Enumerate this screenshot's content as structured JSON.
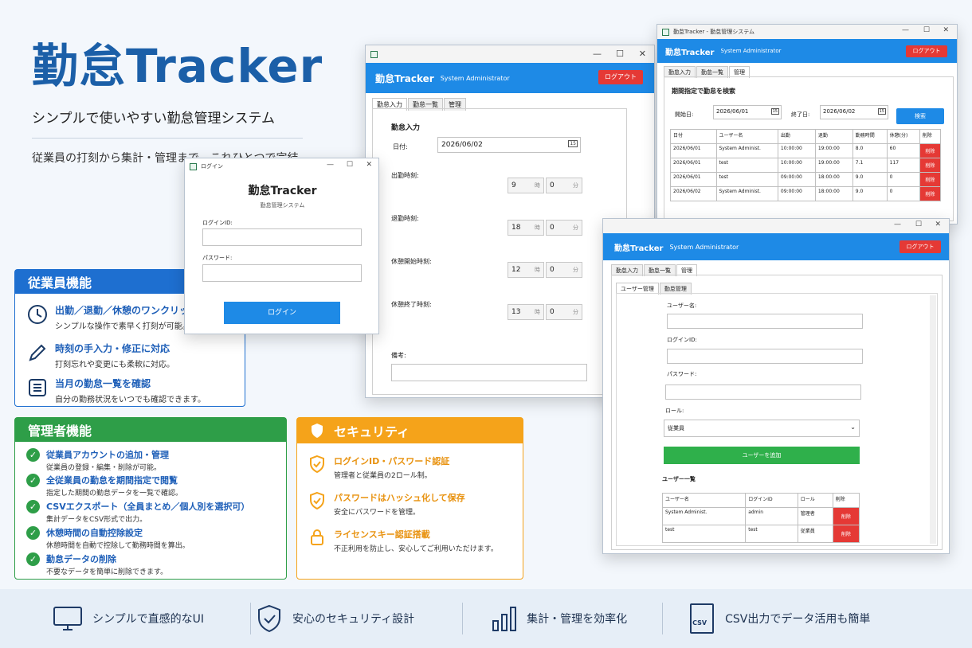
{
  "hero": {
    "title": "勤怠Tracker",
    "subtitle": "シンプルで使いやすい勤怠管理システム",
    "description": "従業員の打刻から集計・管理まで、これひとつで完結。"
  },
  "login_window": {
    "window_title": "ログイン",
    "app_name": "勤怠Tracker",
    "app_caption": "勤怠管理システム",
    "login_id_label": "ログインID:",
    "password_label": "パスワード:",
    "login_button": "ログイン"
  },
  "entry_window": {
    "brand": "勤怠Tracker",
    "user": "System Administrator",
    "logout": "ログアウト",
    "tabs": [
      "勤怠入力",
      "勤怠一覧",
      "管理"
    ],
    "section_title": "勤怠入力",
    "date_label": "日付:",
    "date_value": "2026/06/02",
    "calendar_label": "15",
    "hour_unit": "時",
    "minute_unit": "分",
    "rows": [
      {
        "label": "出勤時刻:",
        "hour": "9",
        "minute": "0"
      },
      {
        "label": "退勤時刻:",
        "hour": "18",
        "minute": "0"
      },
      {
        "label": "休憩開始時刻:",
        "hour": "12",
        "minute": "0"
      },
      {
        "label": "休憩終了時刻:",
        "hour": "13",
        "minute": "0"
      }
    ],
    "note_label": "備考:"
  },
  "list_window": {
    "window_title": "勤怠Tracker - 勤怠管理システム",
    "brand": "勤怠Tracker",
    "user": "System Administrator",
    "logout": "ログアウト",
    "tabs": [
      "勤怠入力",
      "勤怠一覧",
      "管理"
    ],
    "section_title": "期間指定で勤怠を検索",
    "start_label": "開始日:",
    "start_value": "2026/06/01",
    "end_label": "終了日:",
    "end_value": "2026/06/02",
    "calendar_label": "15",
    "search_button": "検索",
    "columns": [
      "日付",
      "ユーザー名",
      "出勤",
      "退勤",
      "勤務時間",
      "休憩(分)",
      "削除"
    ],
    "rows": [
      [
        "2026/06/01",
        "System Administ.",
        "10:00:00",
        "19:00:00",
        "8.0",
        "60",
        "削除"
      ],
      [
        "2026/06/01",
        "test",
        "10:00:00",
        "19:00:00",
        "7.1",
        "117",
        "削除"
      ],
      [
        "2026/06/01",
        "test",
        "09:00:00",
        "18:00:00",
        "9.0",
        "0",
        "削除"
      ],
      [
        "2026/06/02",
        "System Administ.",
        "09:00:00",
        "18:00:00",
        "9.0",
        "0",
        "削除"
      ]
    ]
  },
  "admin_window": {
    "brand": "勤怠Tracker",
    "user": "System Administrator",
    "logout": "ログアウト",
    "tabs": [
      "勤怠入力",
      "勤怠一覧",
      "管理"
    ],
    "sub_tabs": [
      "ユーザー管理",
      "勤怠管理"
    ],
    "username_label": "ユーザー名:",
    "login_id_label": "ログインID:",
    "password_label": "パスワード:",
    "role_label": "ロール:",
    "role_value": "従業員",
    "add_button": "ユーザーを追加",
    "list_title": "ユーザー一覧",
    "columns": [
      "ユーザー名",
      "ログインID",
      "ロール",
      "削除"
    ],
    "rows": [
      [
        "System Administ.",
        "admin",
        "管理者",
        "削除"
      ],
      [
        "test",
        "test",
        "従業員",
        "削除"
      ]
    ]
  },
  "employee_card": {
    "title": "従業員機能",
    "color": "#1e6fd0",
    "items": [
      {
        "title": "出勤／退勤／休憩のワンクリック打刻",
        "desc": "シンプルな操作で素早く打刻が可能。"
      },
      {
        "title": "時刻の手入力・修正に対応",
        "desc": "打刻忘れや変更にも柔軟に対応。"
      },
      {
        "title": "当月の勤怠一覧を確認",
        "desc": "自分の勤務状況をいつでも確認できます。"
      }
    ]
  },
  "admin_card": {
    "title": "管理者機能",
    "color": "#2e9e48",
    "items": [
      {
        "title": "従業員アカウントの追加・管理",
        "desc": "従業員の登録・編集・削除が可能。"
      },
      {
        "title": "全従業員の勤怠を期間指定で閲覧",
        "desc": "指定した期間の勤怠データを一覧で確認。"
      },
      {
        "title": "CSVエクスポート（全員まとめ／個人別を選択可）",
        "desc": "集計データをCSV形式で出力。"
      },
      {
        "title": "休憩時間の自動控除設定",
        "desc": "休憩時間を自動で控除して勤務時間を算出。"
      },
      {
        "title": "勤怠データの削除",
        "desc": "不要なデータを簡単に削除できます。"
      }
    ]
  },
  "security_card": {
    "title": "セキュリティ",
    "color": "#f5a31a",
    "items": [
      {
        "title": "ログインID・パスワード認証",
        "desc": "管理者と従業員の2ロール制。"
      },
      {
        "title": "パスワードはハッシュ化して保存",
        "desc": "安全にパスワードを管理。"
      },
      {
        "title": "ライセンスキー認証搭載",
        "desc": "不正利用を防止し、安心してご利用いただけます。"
      }
    ]
  },
  "footer": {
    "items": [
      {
        "icon": "monitor-icon",
        "label": "シンプルで直感的なUI"
      },
      {
        "icon": "shield-check-icon",
        "label": "安心のセキュリティ設計"
      },
      {
        "icon": "bar-chart-icon",
        "label": "集計・管理を効率化"
      },
      {
        "icon": "csv-file-icon",
        "label": "CSV出力でデータ活用も簡単",
        "badge": "CSV"
      }
    ]
  }
}
